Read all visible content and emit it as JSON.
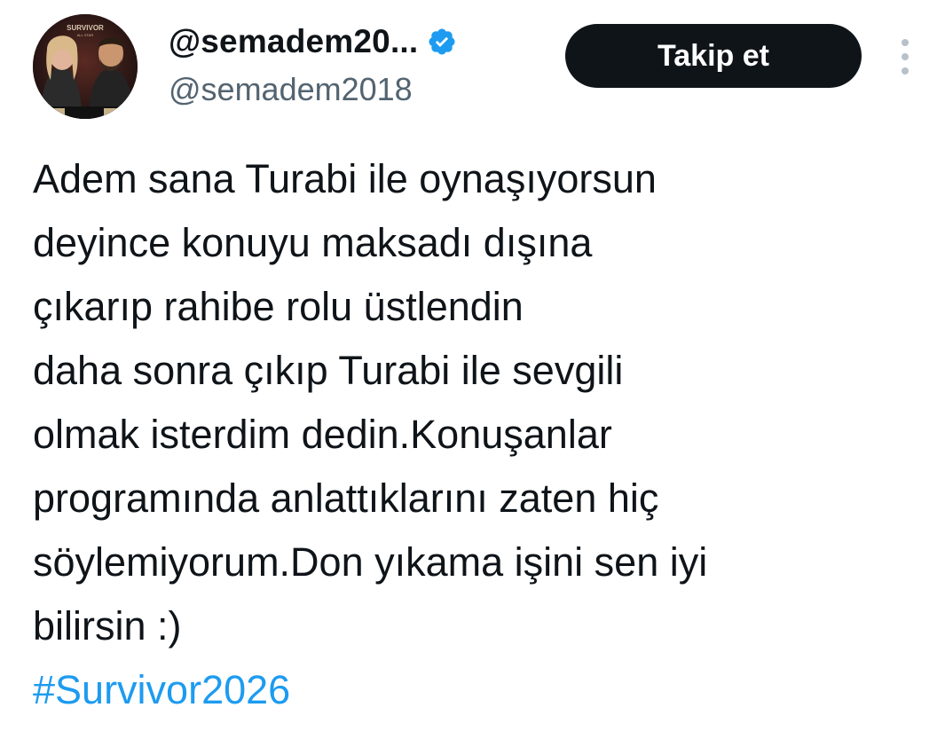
{
  "tweet": {
    "author": {
      "display_name": "@semadem20...",
      "handle": "@semadem2018",
      "verified": true,
      "avatar_icon": "avatar-photo"
    },
    "follow_label": "Takip et",
    "more_icon": "more-vertical-icon",
    "body_lines": [
      "Adem sana Turabi ile oynaşıyorsun",
      "deyince konuyu maksadı dışına",
      "çıkarıp rahibe rolu üstlendin",
      "daha sonra çıkıp Turabi ile sevgili",
      "olmak isterdim dedin.Konuşanlar",
      "programında anlattıklarını zaten hiç",
      "söylemiyorum.Don yıkama işini sen iyi",
      "bilirsin :)"
    ],
    "hashtag": "#Survivor2026",
    "avatar_overlay_text": "SURVIVOR ALL STAR"
  },
  "colors": {
    "text": "#0f1419",
    "secondary": "#536471",
    "accent": "#1d9bf0",
    "button_bg": "#0f1419",
    "button_text": "#ffffff"
  }
}
